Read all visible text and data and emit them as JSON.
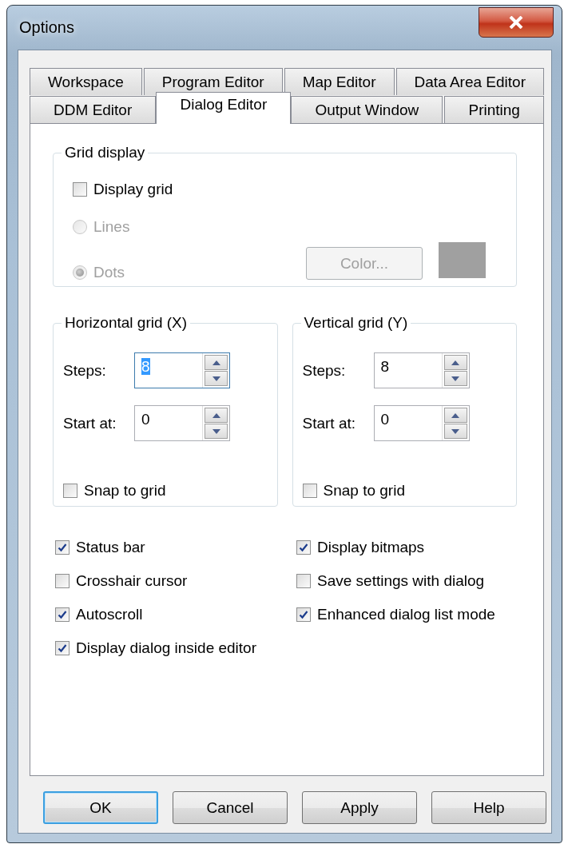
{
  "window": {
    "title": "Options"
  },
  "tab_rows": [
    {
      "tabs": [
        {
          "label": "Workspace",
          "selected": false
        },
        {
          "label": "Program Editor",
          "selected": false
        },
        {
          "label": "Map Editor",
          "selected": false
        },
        {
          "label": "Data Area Editor",
          "selected": false
        }
      ]
    },
    {
      "tabs": [
        {
          "label": "DDM Editor",
          "selected": false
        },
        {
          "label": "Dialog Editor",
          "selected": true
        },
        {
          "label": "Output Window",
          "selected": false
        },
        {
          "label": "Printing",
          "selected": false
        }
      ]
    }
  ],
  "grid_display": {
    "title": "Grid display",
    "display_grid": {
      "label": "Display grid",
      "checked": false
    },
    "styles": [
      {
        "label": "Lines",
        "selected": false,
        "disabled": true
      },
      {
        "label": "Dots",
        "selected": true,
        "disabled": true
      }
    ],
    "color_button": {
      "label": "Color...",
      "disabled": true
    },
    "color": "#a0a0a0"
  },
  "axes": [
    {
      "title": "Horizontal grid (X)",
      "fields": [
        {
          "label": "Steps:",
          "value": "8",
          "focused": true
        },
        {
          "label": "Start at:",
          "value": "0",
          "focused": false
        }
      ],
      "snap": {
        "label": "Snap to grid",
        "checked": false
      }
    },
    {
      "title": "Vertical grid (Y)",
      "fields": [
        {
          "label": "Steps:",
          "value": "8",
          "focused": false
        },
        {
          "label": "Start at:",
          "value": "0",
          "focused": false
        }
      ],
      "snap": {
        "label": "Snap to grid",
        "checked": false
      }
    }
  ],
  "options": [
    {
      "label": "Status bar",
      "checked": true
    },
    {
      "label": "Display bitmaps",
      "checked": true
    },
    {
      "label": "Crosshair cursor",
      "checked": false
    },
    {
      "label": "Save settings with dialog",
      "checked": false
    },
    {
      "label": "Autoscroll",
      "checked": true
    },
    {
      "label": "Enhanced dialog list mode",
      "checked": true
    },
    {
      "label": "Display dialog inside editor",
      "checked": true
    }
  ],
  "buttons": [
    {
      "label": "OK",
      "default": true
    },
    {
      "label": "Cancel",
      "default": false
    },
    {
      "label": "Apply",
      "default": false
    },
    {
      "label": "Help",
      "default": false
    }
  ]
}
